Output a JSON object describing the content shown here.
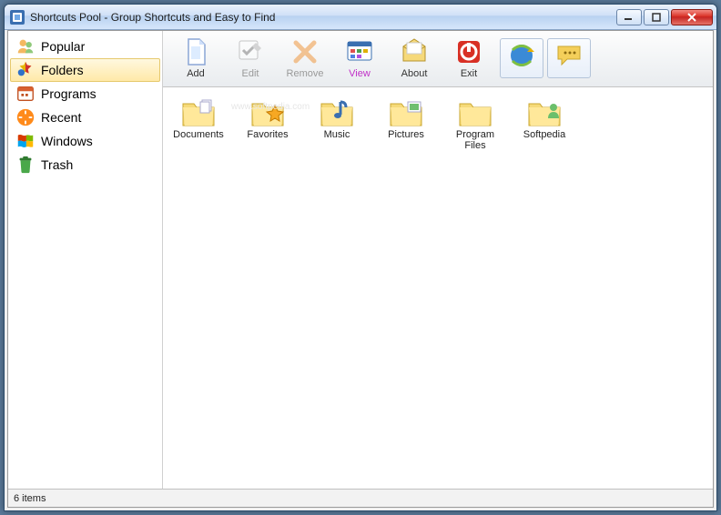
{
  "window": {
    "title": "Shortcuts Pool - Group Shortcuts and Easy to Find"
  },
  "background_watermark": "SOFTPEDIA",
  "sidebar": {
    "items": [
      {
        "label": "Popular",
        "icon": "people-icon"
      },
      {
        "label": "Folders",
        "icon": "star-folder-icon",
        "selected": true
      },
      {
        "label": "Programs",
        "icon": "calendar-icon"
      },
      {
        "label": "Recent",
        "icon": "recent-icon"
      },
      {
        "label": "Windows",
        "icon": "windows-flag-icon"
      },
      {
        "label": "Trash",
        "icon": "trash-icon"
      }
    ]
  },
  "toolbar": {
    "add_label": "Add",
    "edit_label": "Edit",
    "remove_label": "Remove",
    "view_label": "View",
    "about_label": "About",
    "exit_label": "Exit"
  },
  "folders": [
    {
      "label": "Documents",
      "icon": "folder-docs-icon"
    },
    {
      "label": "Favorites",
      "icon": "folder-star-icon"
    },
    {
      "label": "Music",
      "icon": "folder-music-icon"
    },
    {
      "label": "Pictures",
      "icon": "folder-pictures-icon"
    },
    {
      "label": "Program Files",
      "icon": "folder-icon"
    },
    {
      "label": "Softpedia",
      "icon": "folder-user-icon"
    }
  ],
  "main_watermark": "www.softpedia.com",
  "statusbar": {
    "text": "6 items"
  }
}
